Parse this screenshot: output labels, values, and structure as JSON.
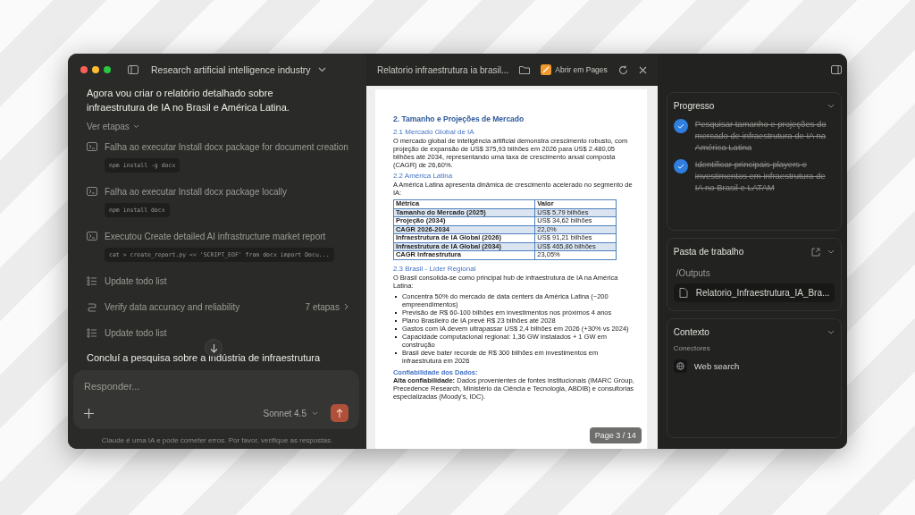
{
  "window": {
    "title": "Research artificial intelligence industry"
  },
  "chat": {
    "intro": "Agora vou criar o relatório detalhado sobre infraestrutura de IA no Brasil e América Latina.",
    "show_steps": "Ver etapas",
    "steps": [
      {
        "kind": "command",
        "label": "Falha ao executar Install docx package for document creation",
        "code": "npm install -g docx"
      },
      {
        "kind": "command",
        "label": "Falha ao executar Install docx package locally",
        "code": "npm install docx"
      },
      {
        "kind": "command",
        "label": "Executou Create detailed AI infrastructure market report",
        "code": "cat > create_report.py << 'SCRIPT_EOF' from docx import Docu..."
      },
      {
        "kind": "todo",
        "label": "Update todo list"
      },
      {
        "kind": "task",
        "label": "Verify data accuracy and reliability",
        "meta": "7 etapas"
      },
      {
        "kind": "todo",
        "label": "Update todo list"
      }
    ],
    "conclusion": "Concluí a pesquisa sobre a indústria de infraestrutura",
    "composer": {
      "placeholder": "Responder...",
      "model": "Sonnet 4.5"
    },
    "disclaimer": "Claude é uma IA e pode cometer erros. Por favor, verifique as respostas."
  },
  "viewer": {
    "title": "Relatorio infraestrutura ia brasil...",
    "open_label": "Abrir em Pages",
    "page_indicator": "Page 3 / 14",
    "document": {
      "heading": "2. Tamanho e Projeções de Mercado",
      "sections": [
        {
          "title": "2.1 Mercado Global de IA",
          "paragraph": "O mercado global de inteligência artificial demonstra crescimento robusto, com projeção de expansão de US$ 375,93 bilhões em 2026 para US$ 2.480,05 bilhões até 2034, representando uma taxa de crescimento anual composta (CAGR) de 26,60%."
        },
        {
          "title": "2.2 América Latina",
          "paragraph": "A América Latina apresenta dinâmica de crescimento acelerado no segmento de IA:",
          "table": {
            "columns": [
              "Métrica",
              "Valor"
            ],
            "rows": [
              [
                "Tamanho do Mercado (2025)",
                "US$ 5,79 bilhões"
              ],
              [
                "Projeção (2034)",
                "US$ 34,62 bilhões"
              ],
              [
                "CAGR 2026-2034",
                "22,0%"
              ],
              [
                "Infraestrutura de IA Global (2026)",
                "US$ 91,21 bilhões"
              ],
              [
                "Infraestrutura de IA Global (2034)",
                "US$ 465,86 bilhões"
              ],
              [
                "CAGR Infraestrutura",
                "23,05%"
              ]
            ]
          }
        },
        {
          "title": "2.3 Brasil - Líder Regional",
          "paragraph": "O Brasil consolida-se como principal hub de infraestrutura de IA na América Latina:",
          "bullets": [
            "Concentra 50% do mercado de data centers da América Latina (~200 empreendimentos)",
            "Previsão de R$ 60-100 bilhões em investimentos nos próximos 4 anos",
            "Plano Brasileiro de IA prevê R$ 23 bilhões até 2028",
            "Gastos com IA devem ultrapassar US$ 2,4 bilhões em 2026 (+30% vs 2024)",
            "Capacidade computacional regional: 1,36 GW instalados + 1 GW em construção",
            "Brasil deve bater recorde de R$ 300 bilhões em investimentos em infraestrutura em 2026"
          ]
        }
      ],
      "note": {
        "title": "Confiabilidade dos Dados:",
        "text": "**Alta confiabilidade:** Dados provenientes de fontes institucionais (IMARC Group, Precedence Research, Ministério da Ciência e Tecnologia, ABDIB) e consultorias especializadas (Moody's, IDC)."
      }
    }
  },
  "sidebar": {
    "progress": {
      "title": "Progresso",
      "items": [
        {
          "label": "Pesquisar tamanho e projeções do mercado de infraestrutura de IA na América Latina",
          "done": true
        },
        {
          "label": "Identificar principais players e investimentos em infraestrutura de IA no Brasil e LATAM",
          "done": true
        }
      ]
    },
    "workspace": {
      "title": "Pasta de trabalho",
      "folder": "/Outputs",
      "file": "Relatorio_Infraestrutura_IA_Bra..."
    },
    "context": {
      "title": "Contexto",
      "connectors_label": "Conectores",
      "connectors": [
        "Web search"
      ]
    }
  }
}
